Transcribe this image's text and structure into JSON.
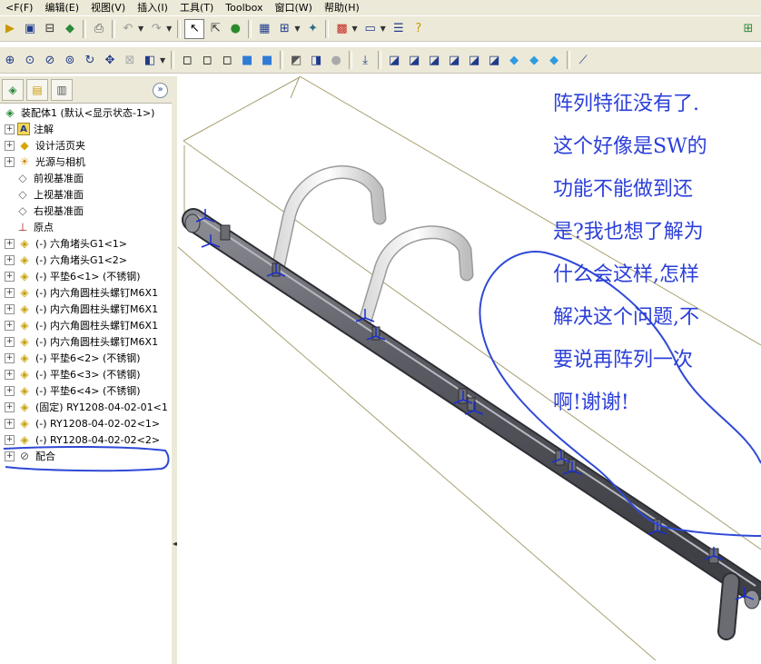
{
  "menu": [
    "<F(F)",
    "编辑(E)",
    "视图(V)",
    "插入(I)",
    "工具(T)",
    "Toolbox",
    "窗口(W)",
    "帮助(H)"
  ],
  "tree": {
    "root_label": "装配体1  (默认<显示状态-1>)",
    "items": [
      {
        "label": "注解",
        "kind": "annotation",
        "expand": "+"
      },
      {
        "label": "设计活页夹",
        "kind": "folder",
        "expand": "+"
      },
      {
        "label": "光源与相机",
        "kind": "lights",
        "expand": "+"
      },
      {
        "label": "前视基准面",
        "kind": "plane",
        "expand": ""
      },
      {
        "label": "上视基准面",
        "kind": "plane",
        "expand": ""
      },
      {
        "label": "右视基准面",
        "kind": "plane",
        "expand": ""
      },
      {
        "label": "原点",
        "kind": "origin",
        "expand": ""
      },
      {
        "label": "(-) 六角堵头G1<1>",
        "kind": "part",
        "expand": "+"
      },
      {
        "label": "(-) 六角堵头G1<2>",
        "kind": "part",
        "expand": "+"
      },
      {
        "label": "(-) 平垫6<1> (不锈钢)",
        "kind": "part",
        "expand": "+"
      },
      {
        "label": "(-) 内六角圆柱头螺钉M6X1",
        "kind": "part",
        "expand": "+"
      },
      {
        "label": "(-) 内六角圆柱头螺钉M6X1",
        "kind": "part",
        "expand": "+"
      },
      {
        "label": "(-) 内六角圆柱头螺钉M6X1",
        "kind": "part",
        "expand": "+"
      },
      {
        "label": "(-) 内六角圆柱头螺钉M6X1",
        "kind": "part",
        "expand": "+"
      },
      {
        "label": "(-) 平垫6<2> (不锈钢)",
        "kind": "part",
        "expand": "+"
      },
      {
        "label": "(-) 平垫6<3> (不锈钢)",
        "kind": "part",
        "expand": "+"
      },
      {
        "label": "(-) 平垫6<4> (不锈钢)",
        "kind": "part",
        "expand": "+"
      },
      {
        "label": "(固定) RY1208-04-02-01<1",
        "kind": "part",
        "expand": "+"
      },
      {
        "label": "(-) RY1208-04-02-02<1>",
        "kind": "part",
        "expand": "+"
      },
      {
        "label": "(-) RY1208-04-02-02<2>",
        "kind": "part",
        "expand": "+"
      },
      {
        "label": "配合",
        "kind": "mates",
        "expand": "+"
      }
    ]
  },
  "annotation_note": {
    "lines": [
      "阵列特征没有了.",
      "这个好像是SW的",
      "功能不能做到还",
      "是?我也想了解为",
      "什么会这样,怎样",
      "解决这个问题,不",
      "要说再阵列一次",
      "啊!谢谢!"
    ],
    "color": "#2b3fd9"
  },
  "colors": {
    "chrome": "#ece9d8",
    "pipe": "#5f6066",
    "bounding_box": "#a8a070",
    "markup_pen": "#2f49d6"
  }
}
